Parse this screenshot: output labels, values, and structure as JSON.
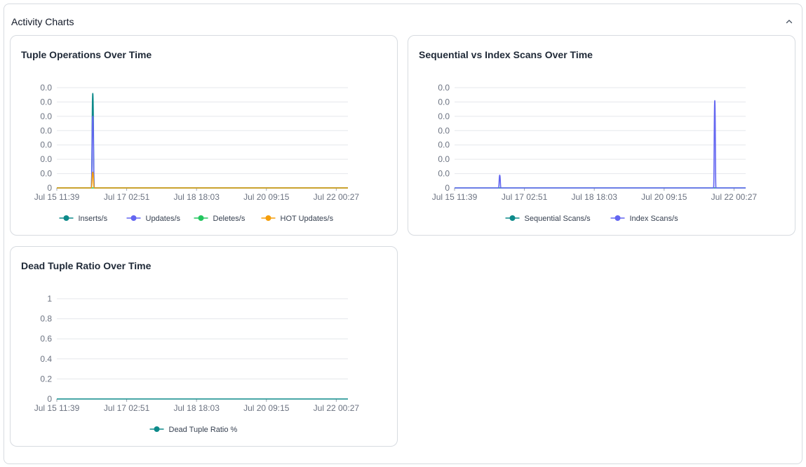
{
  "section": {
    "title": "Activity Charts",
    "collapse_icon": "chevron-up-icon"
  },
  "chart_data": [
    {
      "type": "line",
      "title": "Tuple Operations Over Time",
      "xlabel": "",
      "ylabel": "",
      "x_tick_labels": [
        "Jul 15 11:39",
        "Jul 17 02:51",
        "Jul 18 18:03",
        "Jul 20 09:15",
        "Jul 22 00:27"
      ],
      "y_tick_labels": [
        "0",
        "0.0",
        "0.0",
        "0.0",
        "0.0",
        "0.0",
        "0.0",
        "0.0"
      ],
      "x": [
        "Jul 15 11:39",
        "Jul 16 07:00",
        "Jul 16 07:50",
        "Jul 16 08:40",
        "Jul 16 10:00",
        "Jul 22 07:00"
      ],
      "ylim": [
        0,
        0.07
      ],
      "grid": true,
      "legend": "bottom",
      "series": [
        {
          "name": "Inserts/s",
          "color": "#0d8a8a",
          "values": [
            0,
            0,
            0.066,
            0,
            0,
            0
          ]
        },
        {
          "name": "Updates/s",
          "color": "#6366f1",
          "values": [
            0,
            0,
            0.05,
            0,
            0,
            0
          ]
        },
        {
          "name": "Deletes/s",
          "color": "#22c55e",
          "values": [
            0,
            0,
            0,
            0,
            0,
            0
          ]
        },
        {
          "name": "HOT Updates/s",
          "color": "#f59e0b",
          "values": [
            0,
            0,
            0.011,
            0,
            0,
            0
          ]
        }
      ]
    },
    {
      "type": "line",
      "title": "Sequential vs Index Scans Over Time",
      "xlabel": "",
      "ylabel": "",
      "x_tick_labels": [
        "Jul 15 11:39",
        "Jul 17 02:51",
        "Jul 18 18:03",
        "Jul 20 09:15",
        "Jul 22 00:27"
      ],
      "y_tick_labels": [
        "0",
        "0.0",
        "0.0",
        "0.0",
        "0.0",
        "0.0",
        "0.0",
        "0.0"
      ],
      "x": [
        "Jul 15 11:39",
        "Jul 16 12:20",
        "Jul 16 13:00",
        "Jul 16 13:40",
        "Jul 21 13:00",
        "Jul 21 13:40",
        "Jul 21 14:20",
        "Jul 22 07:00"
      ],
      "ylim": [
        0,
        0.07
      ],
      "grid": true,
      "legend": "bottom",
      "series": [
        {
          "name": "Sequential Scans/s",
          "color": "#0d8a8a",
          "values": [
            0,
            0,
            0,
            0,
            0,
            0,
            0,
            0
          ]
        },
        {
          "name": "Index Scans/s",
          "color": "#6366f1",
          "values": [
            0,
            0,
            0.009,
            0,
            0,
            0.061,
            0,
            0
          ]
        }
      ]
    },
    {
      "type": "line",
      "title": "Dead Tuple Ratio Over Time",
      "xlabel": "",
      "ylabel": "",
      "x_tick_labels": [
        "Jul 15 11:39",
        "Jul 17 02:51",
        "Jul 18 18:03",
        "Jul 20 09:15",
        "Jul 22 00:27"
      ],
      "y_tick_labels": [
        "0",
        "0.2",
        "0.4",
        "0.6",
        "0.8",
        "1"
      ],
      "x": [
        "Jul 15 11:39",
        "Jul 22 07:00"
      ],
      "ylim": [
        0,
        1
      ],
      "grid": true,
      "legend": "bottom",
      "series": [
        {
          "name": "Dead Tuple Ratio %",
          "color": "#0d8a8a",
          "values": [
            0,
            0
          ]
        }
      ]
    }
  ]
}
